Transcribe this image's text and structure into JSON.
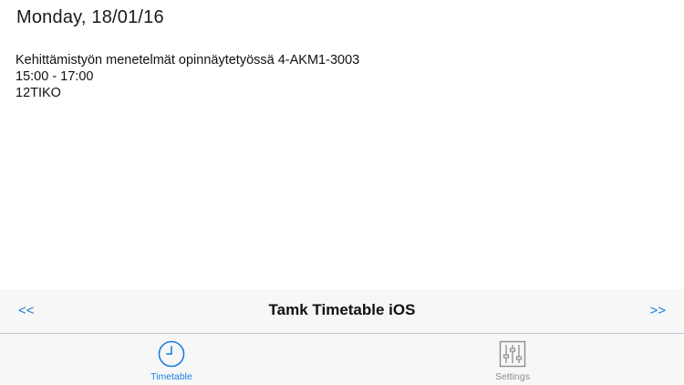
{
  "header": {
    "date": "Monday, 18/01/16"
  },
  "events": [
    {
      "title": "Kehittämistyön menetelmät opinnäytetyössä 4-AKM1-3003",
      "time": "15:00 - 17:00",
      "group": "12TIKO"
    }
  ],
  "nav": {
    "prev_label": "<<",
    "title": "Tamk Timetable iOS",
    "next_label": ">>"
  },
  "tabs": [
    {
      "label": "Timetable",
      "icon": "clock-icon",
      "selected": true,
      "color": "#1a7fe0"
    },
    {
      "label": "Settings",
      "icon": "sliders-icon",
      "selected": false,
      "color": "#8e8e93"
    }
  ],
  "colors": {
    "accent": "#1a7fe0",
    "inactive": "#8e8e93",
    "bar_background": "#f7f7f7"
  }
}
